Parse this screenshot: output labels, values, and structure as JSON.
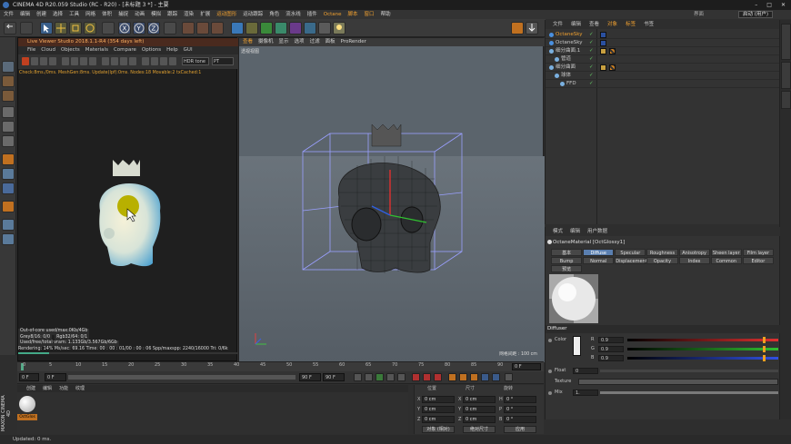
{
  "window": {
    "title": "CINEMA 4D R20.059 Studio (RC - R20) - [未标题 3 *] - 主要"
  },
  "menubar": {
    "items": [
      "文件",
      "编辑",
      "创建",
      "选择",
      "工具",
      "网格",
      "体积",
      "捕捉",
      "动画",
      "模拟",
      "跟踪",
      "渲染",
      "扩展",
      "运动图形",
      "运动跟踪",
      "角色",
      "流水线",
      "插件",
      "Octane",
      "脚本",
      "窗口",
      "帮助"
    ],
    "highlighted": [
      "运动图形",
      "Octane",
      "脚本",
      "窗口"
    ],
    "interface_label": "界面",
    "layout_value": "启动 (用户)"
  },
  "live_viewer": {
    "title": "Live Viewer Studio 2018.1.1-R4 (354 days left)",
    "menu": [
      "File",
      "Cloud",
      "Objects",
      "Materials",
      "Compare",
      "Options",
      "Help",
      "GUI"
    ],
    "tonemap": "HDR tone",
    "kernel": "PT",
    "status": "Check:8ms./0ms. MeshGen:8ms. Update(lpf):0ms. Nodes:18 Movable:2 txCached:1",
    "stats": {
      "out_of_core": "Out-of-core used/max:0Kb/4Gb",
      "grey": "Grey8/16: 0/0",
      "rgb": "Rgb32/64: 0/1",
      "vram": "Used/free/total vram: 1.133Gb/3.567Gb/6Gb",
      "rendering": "Rendering: 14%",
      "msps": "Ms/sec: 69.16",
      "time": "Time: 00 : 00 : 01/00 : 00 : 06",
      "spp": "Spp/maxspp: 2240/16000",
      "tri": "Tri: 0/6k",
      "mesh": "Mesh: 1",
      "hair": "Hair: 0"
    }
  },
  "viewport": {
    "menu": [
      "查看",
      "摄像机",
      "显示",
      "选项",
      "过滤",
      "面板",
      "ProRender"
    ],
    "label": "透视视图",
    "grid_scale": "网格间距 : 100 cm"
  },
  "object_manager": {
    "menu": [
      "文件",
      "编辑",
      "查看",
      "对象",
      "标签",
      "书签"
    ],
    "highlighted": [
      "对象",
      "标签"
    ],
    "objects": [
      {
        "name": "OctaneSky",
        "indent": 0,
        "color": "#f0a030"
      },
      {
        "name": "OctaneSky",
        "indent": 0,
        "color": "#c8c8c8"
      },
      {
        "name": "细分曲面.1",
        "indent": 0,
        "color": "#c8c8c8"
      },
      {
        "name": "管道",
        "indent": 1,
        "color": "#c8c8c8"
      },
      {
        "name": "细分曲面",
        "indent": 0,
        "color": "#c8c8c8"
      },
      {
        "name": "球体",
        "indent": 1,
        "color": "#c8c8c8"
      },
      {
        "name": "FFD",
        "indent": 2,
        "color": "#c8c8c8"
      }
    ]
  },
  "attributes": {
    "menu": [
      "模式",
      "编辑",
      "用户数据"
    ],
    "material_title": "OctaneMaterial [OctGlossy1]",
    "tabs_row1": [
      "基本",
      "Diffuse",
      "Specular",
      "Roughness",
      "Anisotropy",
      "Sheen layer",
      "Film layer"
    ],
    "tabs_row2": [
      "Bump",
      "Normal",
      "Displacement",
      "Opacity",
      "Index",
      "Common",
      "Editor"
    ],
    "tabs_row3": [
      "预览"
    ],
    "active_tab": "Diffuse",
    "section": "Diffuser",
    "color_label": "Color",
    "r_label": "R",
    "r_value": "0.9",
    "g_label": "G",
    "g_value": "0.9",
    "b_label": "B",
    "b_value": "0.9",
    "float_label": "Float",
    "float_value": "0",
    "texture_label": "Texture",
    "mix_label": "Mix",
    "mix_value": "1."
  },
  "timeline": {
    "ticks": [
      "0",
      "5",
      "10",
      "15",
      "20",
      "25",
      "30",
      "35",
      "40",
      "45",
      "50",
      "55",
      "60",
      "65",
      "70",
      "75",
      "80",
      "85",
      "90"
    ],
    "end_frame": "0 F",
    "start_frame": "0 F",
    "min_frame": "0 F",
    "max_frame": "90 F",
    "max_frame2": "90 F"
  },
  "material_manager": {
    "menu": [
      "创建",
      "编辑",
      "功能",
      "纹理"
    ],
    "material_name": "OctGlos"
  },
  "coordinates": {
    "headers": [
      "位置",
      "尺寸",
      "旋转"
    ],
    "x_label": "X",
    "x_value": "0 cm",
    "y_label": "Y",
    "y_value": "0 cm",
    "z_label": "Z",
    "z_value": "0 cm",
    "sx_value": "0 cm",
    "sy_value": "0 cm",
    "sz_value": "0 cm",
    "h_label": "H",
    "h_value": "0 °",
    "p_label": "P",
    "p_value": "0 °",
    "b_label": "B",
    "b_value": "0 °",
    "mode1": "对象 (相对)",
    "mode2": "绝对尺寸",
    "apply": "应用"
  },
  "statusbar": {
    "text": "Updated: 0 ms."
  },
  "brand": {
    "logo": "MAXON CINEMA 4D",
    "watermark": "D"
  },
  "colors": {
    "accent_orange": "#f0a030",
    "selection_blue": "#5a7fb0"
  }
}
